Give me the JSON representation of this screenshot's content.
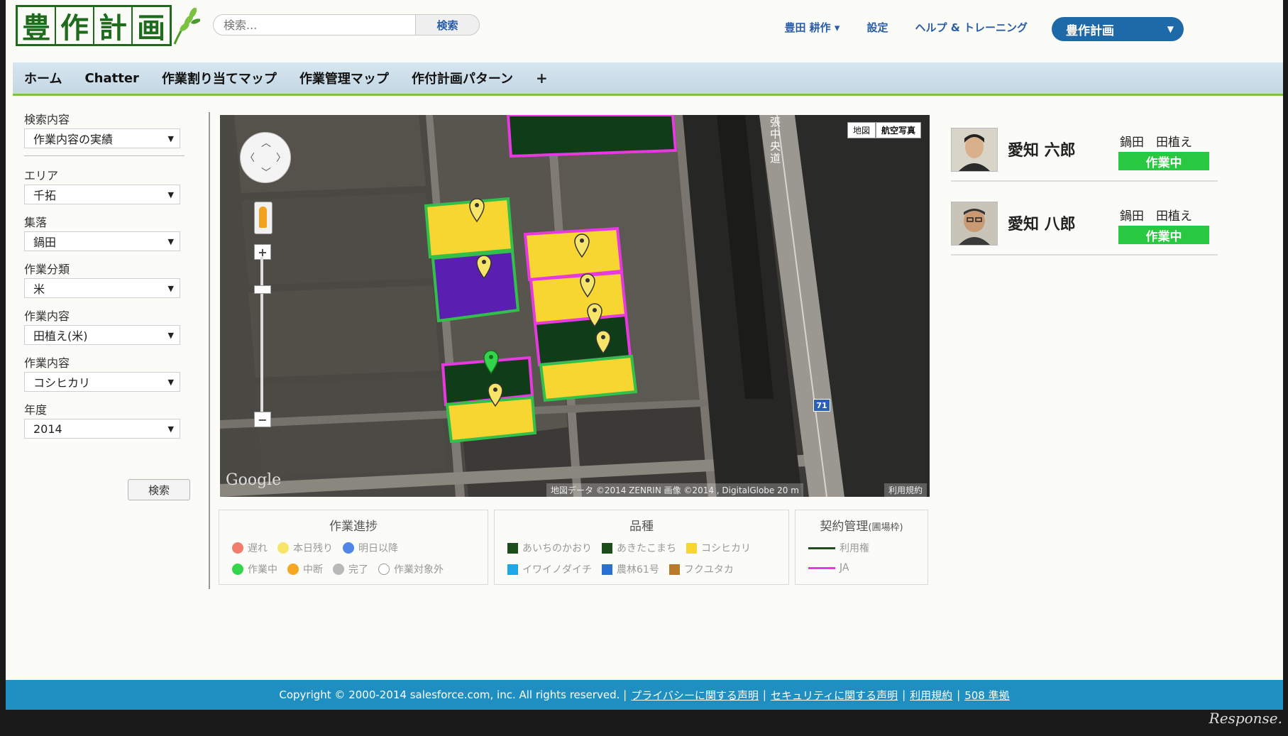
{
  "header": {
    "logo_chars": [
      "豊",
      "作",
      "計",
      "画"
    ],
    "search_placeholder": "検索...",
    "search_button": "検索",
    "nav": {
      "user": "豊田 耕作",
      "settings": "設定",
      "help": "ヘルプ & トレーニング"
    },
    "app_menu": "豊作計画"
  },
  "tabs": [
    "ホーム",
    "Chatter",
    "作業割り当てマップ",
    "作業管理マップ",
    "作付計画パターン"
  ],
  "tab_add": "+",
  "sidebar": {
    "fields": [
      {
        "label": "検索内容",
        "value": "作業内容の実績"
      },
      {
        "label": "エリア",
        "value": "千拓"
      },
      {
        "label": "集落",
        "value": "鍋田"
      },
      {
        "label": "作業分類",
        "value": "米"
      },
      {
        "label": "作業内容",
        "value": "田植え(米)"
      },
      {
        "label": "作業内容",
        "value": "コシヒカリ"
      },
      {
        "label": "年度",
        "value": "2014"
      }
    ],
    "search_button": "検索"
  },
  "map": {
    "type_map": "地図",
    "type_satellite": "航空写真",
    "credit": "地図データ ©2014 ZENRIN 画像 ©2014 , DigitalGlobe   20 m",
    "terms": "利用規約",
    "google": "Google",
    "road_label": "張中央道",
    "route_number": "71",
    "zoom_in": "+",
    "zoom_out": "−"
  },
  "legend": {
    "progress": {
      "title": "作業進捗",
      "items": [
        {
          "label": "遅れ",
          "color": "#f07d6e"
        },
        {
          "label": "本日残り",
          "color": "#f7e56a"
        },
        {
          "label": "明日以降",
          "color": "#4f86e8"
        },
        {
          "label": "作業中",
          "color": "#33d64a"
        },
        {
          "label": "中断",
          "color": "#f5a623"
        },
        {
          "label": "完了",
          "color": "#b8b8b8"
        },
        {
          "label": "作業対象外",
          "color": "#ffffff"
        }
      ]
    },
    "variety": {
      "title": "品種",
      "items": [
        {
          "label": "あいちのかおり",
          "color": "#1b4e1b"
        },
        {
          "label": "あきたこまち",
          "color": "#1b4e1b"
        },
        {
          "label": "コシヒカリ",
          "color": "#f7d631"
        },
        {
          "label": "イワイノダイチ",
          "color": "#1ea7e8"
        },
        {
          "label": "農林61号",
          "color": "#2a6fd6"
        },
        {
          "label": "フクユタカ",
          "color": "#b97a2a"
        }
      ]
    },
    "contract": {
      "title": "契約管理",
      "title_suffix": "(圃場枠)",
      "items": [
        {
          "label": "利用権",
          "color": "#1b4e1b"
        },
        {
          "label": "JA",
          "color": "#e838e0"
        }
      ]
    }
  },
  "people": [
    {
      "name": "愛知 六郎",
      "task": "鍋田　田植え",
      "status": "作業中"
    },
    {
      "name": "愛知 八郎",
      "task": "鍋田　田植え",
      "status": "作業中"
    }
  ],
  "footer": {
    "copyright": "Copyright © 2000-2014 salesforce.com, inc. All rights reserved. |",
    "links": [
      "プライバシーに関する声明",
      "セキュリティに関する声明",
      "利用規約",
      "508 準拠"
    ]
  },
  "watermark": "Response."
}
